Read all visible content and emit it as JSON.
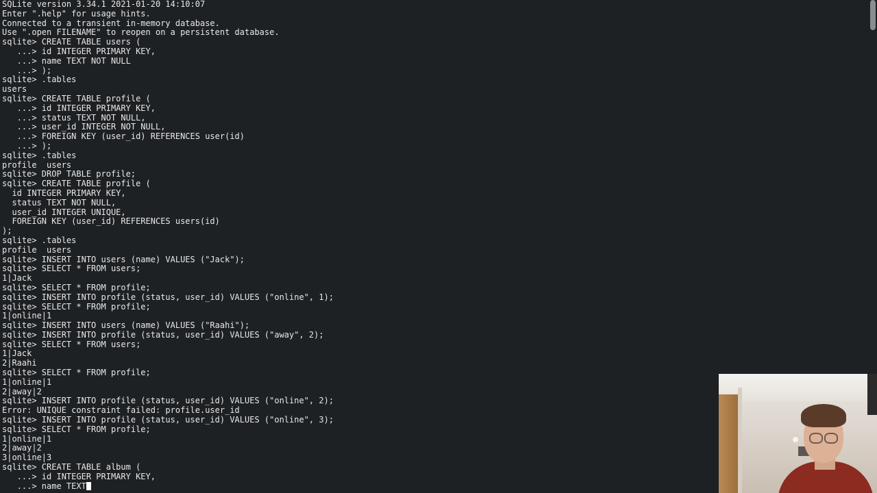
{
  "terminal": {
    "lines": [
      "SQLite version 3.34.1 2021-01-20 14:10:07",
      "Enter \".help\" for usage hints.",
      "Connected to a transient in-memory database.",
      "Use \".open FILENAME\" to reopen on a persistent database.",
      "sqlite> CREATE TABLE users (",
      "   ...> id INTEGER PRIMARY KEY,",
      "   ...> name TEXT NOT NULL",
      "   ...> );",
      "sqlite> .tables",
      "users",
      "sqlite> CREATE TABLE profile (",
      "   ...> id INTEGER PRIMARY KEY,",
      "   ...> status TEXT NOT NULL,",
      "   ...> user_id INTEGER NOT NULL,",
      "   ...> FOREIGN KEY (user_id) REFERENCES user(id)",
      "   ...> );",
      "sqlite> .tables",
      "profile  users",
      "sqlite> DROP TABLE profile;",
      "sqlite> CREATE TABLE profile (",
      "  id INTEGER PRIMARY KEY,",
      "  status TEXT NOT NULL,",
      "  user_id INTEGER UNIQUE,",
      "  FOREIGN KEY (user_id) REFERENCES users(id)",
      ");",
      "sqlite> .tables",
      "profile  users",
      "sqlite> INSERT INTO users (name) VALUES (\"Jack\");",
      "sqlite> SELECT * FROM users;",
      "1|Jack",
      "sqlite> SELECT * FROM profile;",
      "sqlite> INSERT INTO profile (status, user_id) VALUES (\"online\", 1);",
      "sqlite> SELECT * FROM profile;",
      "1|online|1",
      "sqlite> INSERT INTO users (name) VALUES (\"Raahi\");",
      "sqlite> INSERT INTO profile (status, user_id) VALUES (\"away\", 2);",
      "sqlite> SELECT * FROM users;",
      "1|Jack",
      "2|Raahi",
      "sqlite> SELECT * FROM profile;",
      "1|online|1",
      "2|away|2",
      "sqlite> INSERT INTO profile (status, user_id) VALUES (\"online\", 2);",
      "Error: UNIQUE constraint failed: profile.user_id",
      "sqlite> INSERT INTO profile (status, user_id) VALUES (\"online\", 3);",
      "sqlite> SELECT * FROM profile;",
      "1|online|1",
      "2|away|2",
      "3|online|3",
      "sqlite> CREATE TABLE album (",
      "   ...> id INTEGER PRIMARY KEY,"
    ],
    "current_input": "   ...> name TEXT"
  },
  "colors": {
    "background": "#1e2124",
    "foreground": "#e8e8e8",
    "cursor": "#ffffff"
  }
}
